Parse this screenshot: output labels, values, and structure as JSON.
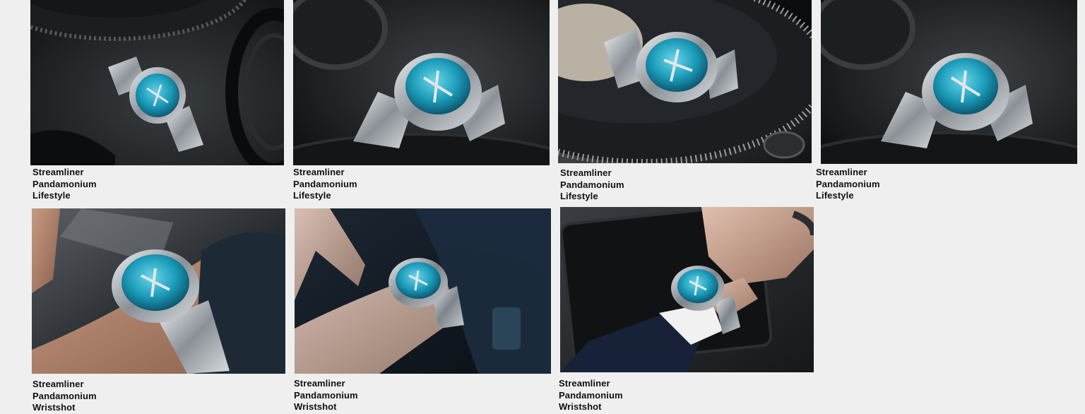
{
  "gallery": {
    "items": [
      {
        "lines": [
          "Streamliner",
          "Pandamonium",
          "Lifestyle"
        ],
        "image": "watch-on-turntable-top-view-image"
      },
      {
        "lines": [
          "Streamliner",
          "Pandamonium",
          "Lifestyle"
        ],
        "image": "watch-on-record-closeup-image"
      },
      {
        "lines": [
          "Streamliner",
          "Pandamonium",
          "Lifestyle"
        ],
        "image": "watch-on-vinyl-record-image"
      },
      {
        "lines": [
          "Streamliner",
          "Pandamonium",
          "Lifestyle"
        ],
        "image": "watch-on-record-closeup-image"
      },
      {
        "lines": [
          "Streamliner",
          "Pandamonium",
          "Wristshot"
        ],
        "image": "wristshot-hand-on-console-image"
      },
      {
        "lines": [
          "Streamliner",
          "Pandamonium",
          "Wristshot"
        ],
        "image": "wristshot-dark-interior-image"
      },
      {
        "lines": [
          "Streamliner",
          "Pandamonium",
          "Wristshot"
        ],
        "image": "wristshot-suit-tablet-image"
      }
    ]
  },
  "colors": {
    "background": "#efefef",
    "caption_text": "#111111",
    "dial_blue": "#1a9ab8",
    "steel": "#b9bec3"
  }
}
